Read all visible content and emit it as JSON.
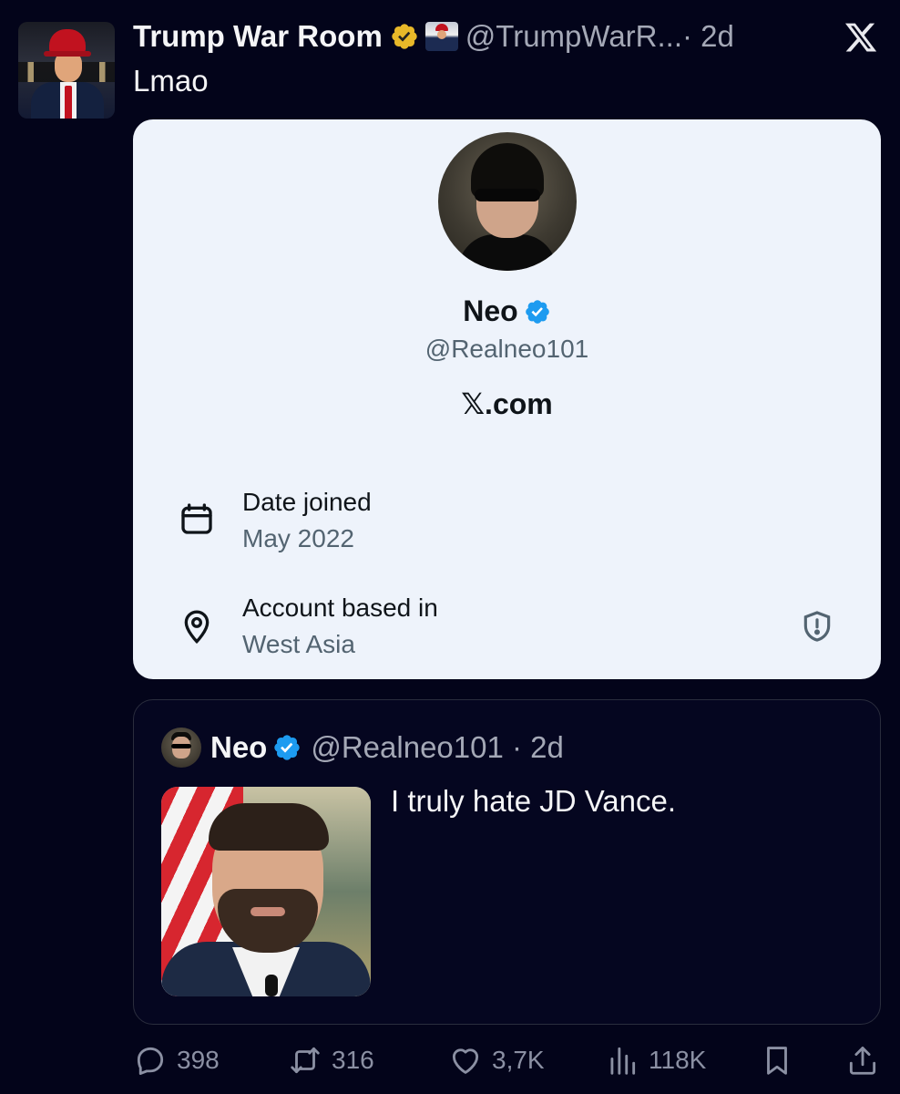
{
  "post": {
    "display_name": "Trump War Room",
    "handle_time": "@TrumpWarR...· 2d",
    "text": "Lmao"
  },
  "profile_card": {
    "name": "Neo",
    "handle": "@Realneo101",
    "site": "𝕏.com",
    "date_joined_label": "Date joined",
    "date_joined_value": "May 2022",
    "location_label": "Account based in",
    "location_value": "West Asia"
  },
  "quote": {
    "name": "Neo",
    "handle_time": "@Realneo101 · 2d",
    "text": "I truly hate JD Vance."
  },
  "actions": {
    "replies": "398",
    "reposts": "316",
    "likes": "3,7K",
    "views": "118K"
  },
  "colors": {
    "background": "#03041a",
    "card": "#eef3fb",
    "verified_blue": "#1d9bf0",
    "verified_gold": "#e8b829",
    "muted_text": "#8b90a3"
  },
  "icons": [
    "x-logo-icon",
    "gold-verified-icon",
    "blue-verified-icon",
    "calendar-icon",
    "location-pin-icon",
    "shield-alert-icon",
    "reply-icon",
    "repost-icon",
    "like-icon",
    "views-icon",
    "bookmark-icon",
    "share-icon"
  ]
}
